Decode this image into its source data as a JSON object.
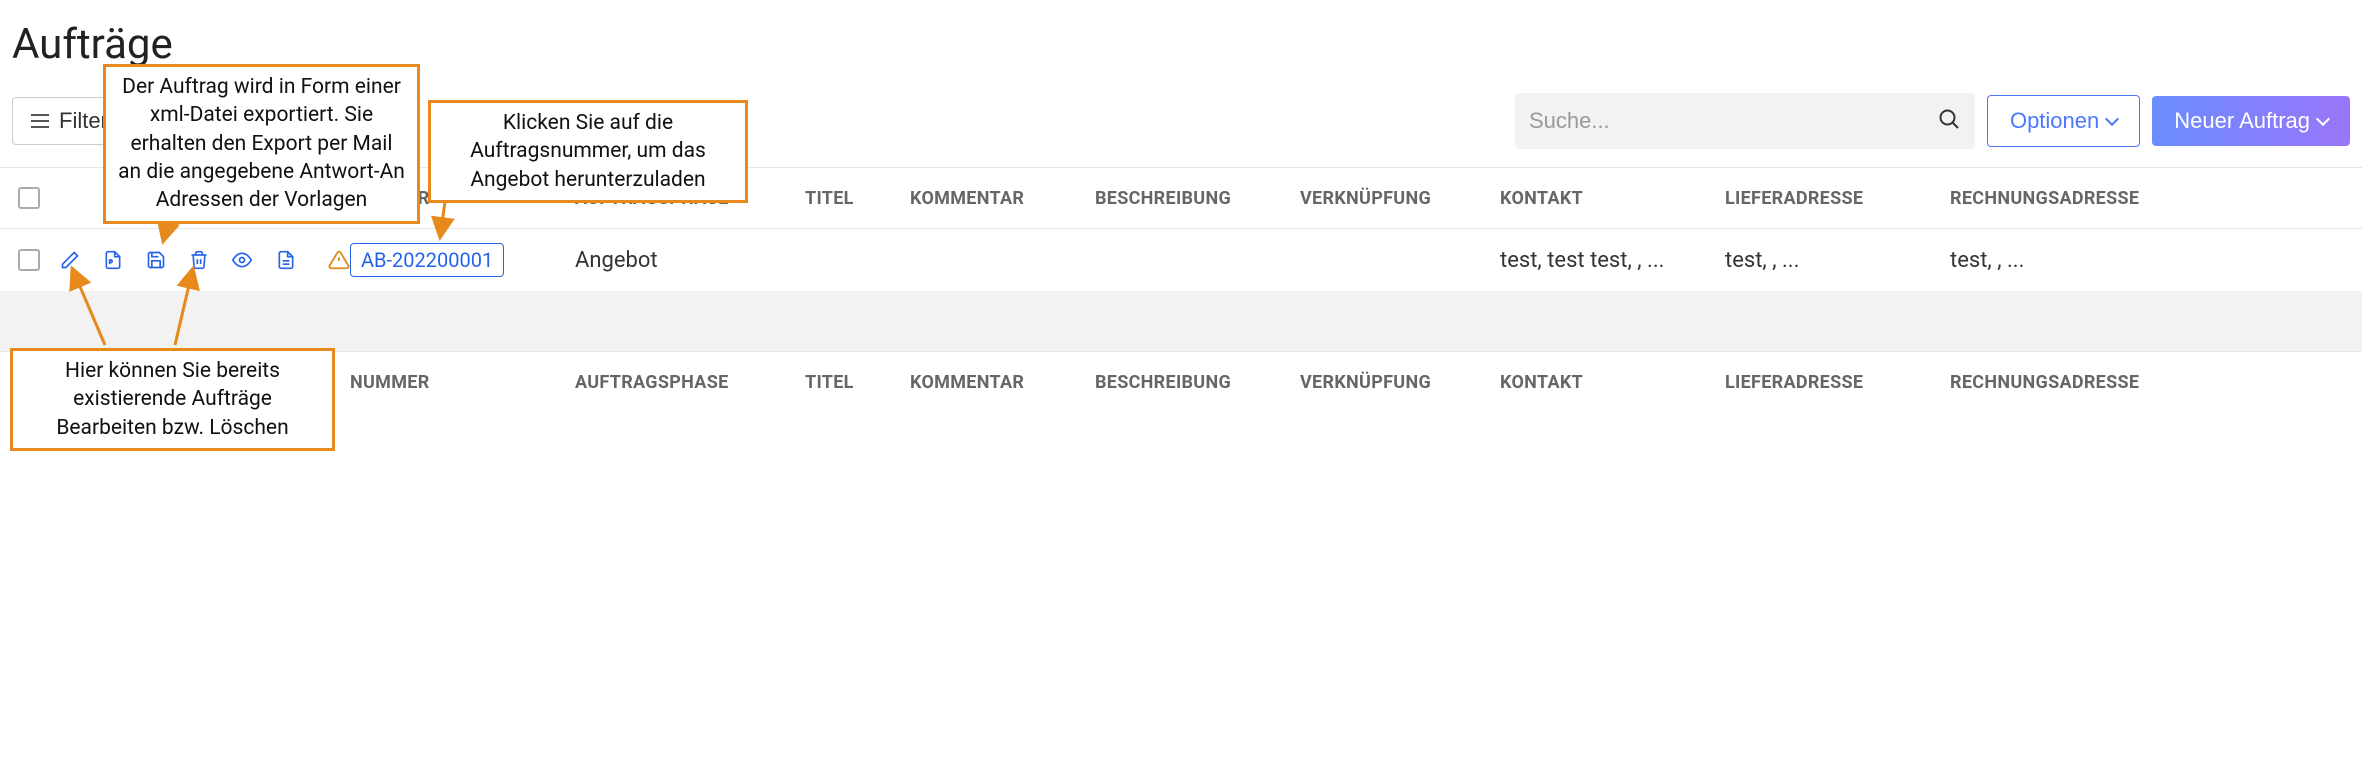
{
  "page": {
    "title": "Aufträge"
  },
  "toolbar": {
    "filter_label": "Filter",
    "search_placeholder": "Suche...",
    "options_label": "Optionen",
    "new_order_label": "Neuer Auftrag"
  },
  "columns": {
    "nummer": "NUMMER",
    "phase": "AUFTRAGSPHASE",
    "titel": "TITEL",
    "kommentar": "KOMMENTAR",
    "beschreibung": "BESCHREIBUNG",
    "verknuepfung": "VERKNÜPFUNG",
    "kontakt": "KONTAKT",
    "liefer": "LIEFERADRESSE",
    "rechnung": "RECHNUNGSADRESSE"
  },
  "rows": [
    {
      "nummer": "AB-202200001",
      "phase": "Angebot",
      "titel": "",
      "kommentar": "",
      "beschreibung": "",
      "verknuepfung": "",
      "kontakt": "test, test test, , ...",
      "liefer": "test, , ...",
      "rechnung": "test, , ..."
    }
  ],
  "callouts": {
    "export": "Der Auftrag wird in Form einer xml-Datei exportiert. Sie erhalten den Export per Mail an die angegebene Antwort-An Adressen der Vorlagen",
    "nummer": "Klicken Sie auf die Auftragsnummer, um das Angebot herunterzuladen",
    "edit": "Hier können Sie bereits existierende Aufträge Bearbeiten bzw. Löschen"
  }
}
